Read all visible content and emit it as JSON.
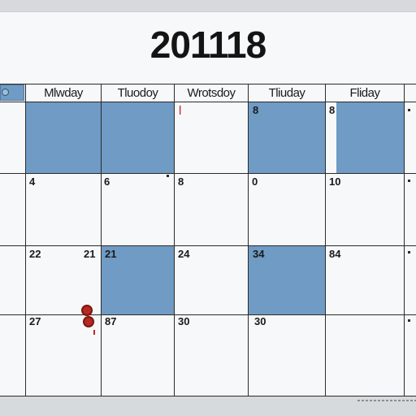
{
  "calendar": {
    "year_title": "201118",
    "weekdays": [
      "Mlwday",
      "Tluodoy",
      "Wrotsdoy",
      "Tliuday",
      "Fliday"
    ],
    "rows": [
      [
        "",
        "",
        "l",
        "8",
        "8"
      ],
      [
        "4",
        "6",
        "8",
        "0",
        "10"
      ],
      [
        "22",
        "21",
        "24",
        "34",
        "84"
      ],
      [
        "27",
        "87",
        "30",
        "30",
        ""
      ]
    ],
    "row_extra_left": [
      "",
      "",
      "21",
      ""
    ],
    "colors": {
      "shaded": "#6f9bc4",
      "grid": "#2b2b2b",
      "marker_red": "#b52a22"
    }
  }
}
